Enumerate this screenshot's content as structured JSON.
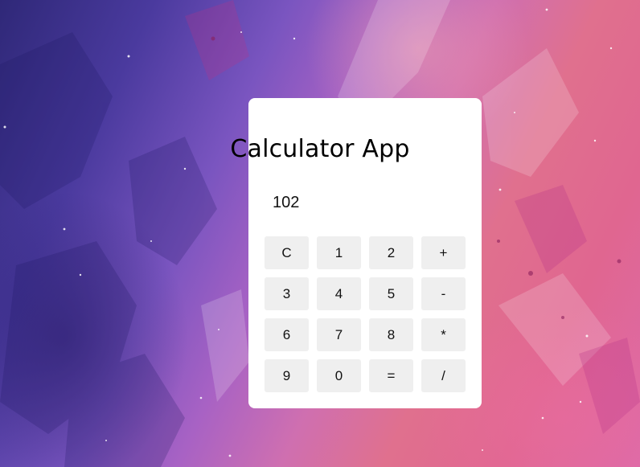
{
  "app": {
    "title": "Calculator App",
    "display_value": "102"
  },
  "keypad": {
    "keys": [
      "C",
      "1",
      "2",
      "+",
      "3",
      "4",
      "5",
      "-",
      "6",
      "7",
      "8",
      "*",
      "9",
      "0",
      "=",
      "/"
    ]
  },
  "colors": {
    "card_background": "#ffffff",
    "key_background": "#efefef",
    "background_deep": "#2f2878",
    "background_purple": "#7a55c0",
    "background_pink": "#e0708e"
  }
}
